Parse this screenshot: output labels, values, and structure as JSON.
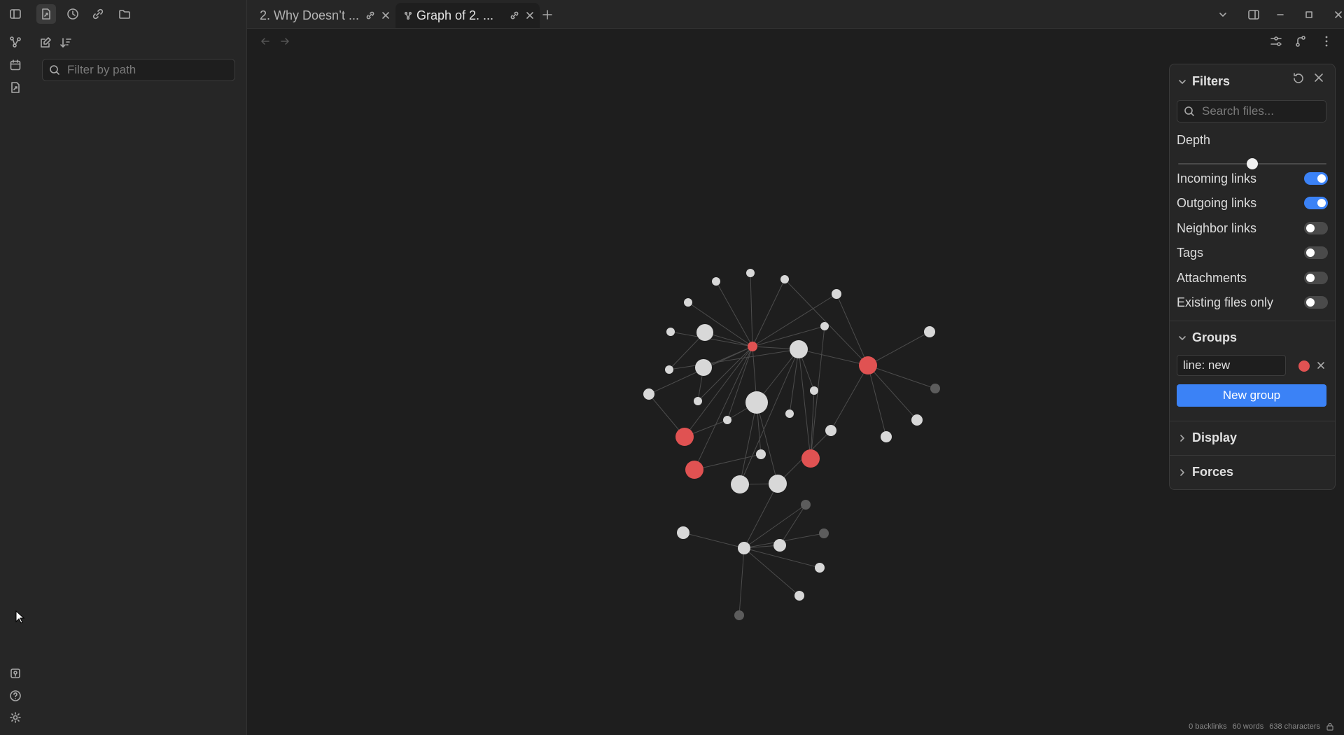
{
  "tabs": [
    {
      "label": "2. Why Doesn’t ...",
      "active": false
    },
    {
      "label": "Graph of 2. ...",
      "active": true
    }
  ],
  "sidebar": {
    "filter_placeholder": "Filter by path"
  },
  "filters": {
    "title": "Filters",
    "search_placeholder": "Search files...",
    "depth_label": "Depth",
    "depth_value": 0.5,
    "toggles": [
      {
        "label": "Incoming links",
        "on": true
      },
      {
        "label": "Outgoing links",
        "on": true
      },
      {
        "label": "Neighbor links",
        "on": false
      },
      {
        "label": "Tags",
        "on": false
      },
      {
        "label": "Attachments",
        "on": false
      },
      {
        "label": "Existing files only",
        "on": false
      }
    ]
  },
  "groups": {
    "title": "Groups",
    "items": [
      {
        "query": "line: new",
        "color": "#e05252"
      }
    ],
    "new_group_label": "New group"
  },
  "display": {
    "title": "Display"
  },
  "forces": {
    "title": "Forces"
  },
  "status": {
    "backlinks": "0 backlinks",
    "words": "60 words",
    "characters": "638 characters"
  },
  "colors": {
    "accent": "#3b82f6",
    "node_default": "#d8d8d8",
    "node_group": "#e05252",
    "node_dim": "#5c5c5c",
    "link": "#4c4c4c"
  }
}
